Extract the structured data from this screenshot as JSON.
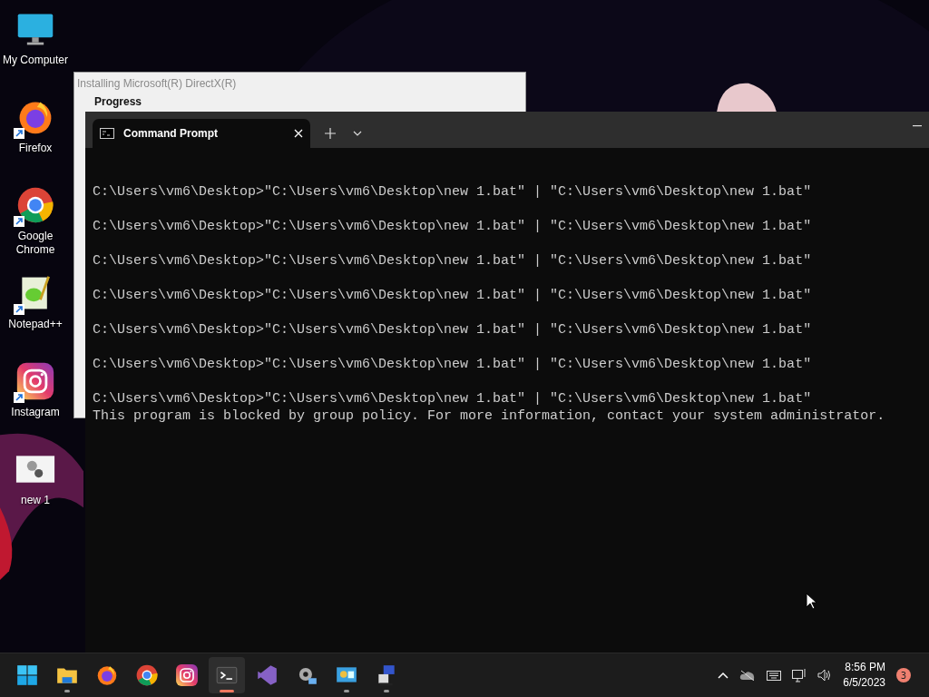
{
  "desktop_icons": [
    {
      "kind": "computer",
      "label": "My Computer",
      "shortcut": false
    },
    {
      "kind": "firefox",
      "label": "Firefox",
      "shortcut": true
    },
    {
      "kind": "chrome",
      "label": "Google Chrome",
      "shortcut": true
    },
    {
      "kind": "notepad",
      "label": "Notepad++",
      "shortcut": true
    },
    {
      "kind": "instagram",
      "label": "Instagram",
      "shortcut": true
    },
    {
      "kind": "batch",
      "label": "new 1",
      "shortcut": false
    }
  ],
  "background_window": {
    "title": "Installing Microsoft(R) DirectX(R)",
    "heading": "Progress"
  },
  "terminal": {
    "tab_title": "Command Prompt",
    "lines": [
      {
        "kind": "command",
        "text": "C:\\Users\\vm6\\Desktop>\"C:\\Users\\vm6\\Desktop\\new 1.bat\" | \"C:\\Users\\vm6\\Desktop\\new 1.bat\""
      },
      {
        "kind": "command",
        "text": "C:\\Users\\vm6\\Desktop>\"C:\\Users\\vm6\\Desktop\\new 1.bat\" | \"C:\\Users\\vm6\\Desktop\\new 1.bat\""
      },
      {
        "kind": "command",
        "text": "C:\\Users\\vm6\\Desktop>\"C:\\Users\\vm6\\Desktop\\new 1.bat\" | \"C:\\Users\\vm6\\Desktop\\new 1.bat\""
      },
      {
        "kind": "command",
        "text": "C:\\Users\\vm6\\Desktop>\"C:\\Users\\vm6\\Desktop\\new 1.bat\" | \"C:\\Users\\vm6\\Desktop\\new 1.bat\""
      },
      {
        "kind": "command",
        "text": "C:\\Users\\vm6\\Desktop>\"C:\\Users\\vm6\\Desktop\\new 1.bat\" | \"C:\\Users\\vm6\\Desktop\\new 1.bat\""
      },
      {
        "kind": "command",
        "text": "C:\\Users\\vm6\\Desktop>\"C:\\Users\\vm6\\Desktop\\new 1.bat\" | \"C:\\Users\\vm6\\Desktop\\new 1.bat\""
      },
      {
        "kind": "command",
        "text": "C:\\Users\\vm6\\Desktop>\"C:\\Users\\vm6\\Desktop\\new 1.bat\" | \"C:\\Users\\vm6\\Desktop\\new 1.bat\""
      },
      {
        "kind": "output",
        "text": "This program is blocked by group policy. For more information, contact your system administrator."
      }
    ]
  },
  "taskbar": {
    "apps": [
      {
        "kind": "start",
        "running": false,
        "selected": false
      },
      {
        "kind": "files",
        "running": true,
        "selected": false
      },
      {
        "kind": "firefox",
        "running": false,
        "selected": false
      },
      {
        "kind": "chrome",
        "running": false,
        "selected": false
      },
      {
        "kind": "instagram",
        "running": false,
        "selected": false
      },
      {
        "kind": "terminal",
        "running": true,
        "selected": true
      },
      {
        "kind": "studio",
        "running": false,
        "selected": false
      },
      {
        "kind": "settings",
        "running": false,
        "selected": false
      },
      {
        "kind": "panel",
        "running": true,
        "selected": false
      },
      {
        "kind": "network",
        "running": true,
        "selected": false
      }
    ],
    "time": "8:56 PM",
    "date": "6/5/2023",
    "notification_count": "3"
  }
}
